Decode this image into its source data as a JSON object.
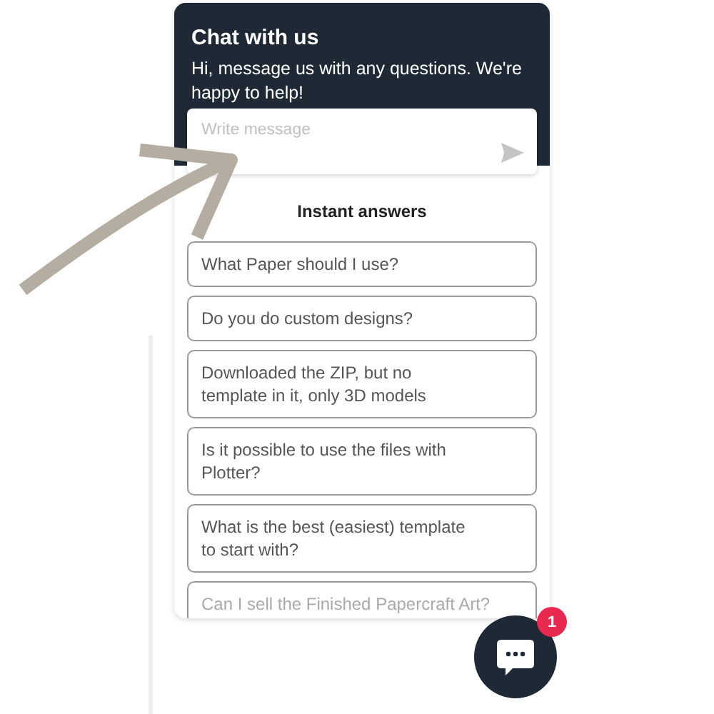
{
  "chat": {
    "title": "Chat with us",
    "subtitle": "Hi, message us with any questions. We're happy to help!",
    "message": {
      "placeholder": "Write message"
    },
    "section_title": "Instant answers",
    "answers": [
      {
        "text": "What Paper should I use?"
      },
      {
        "text": "Do you do custom designs?"
      },
      {
        "text": "Downloaded the ZIP, but no template in it, only 3D models"
      },
      {
        "text": "Is it possible to use the files with Plotter?"
      },
      {
        "text": "What is the best (easiest) template to start with?"
      },
      {
        "text": "Can I sell the Finished Papercraft Art?"
      }
    ]
  },
  "launcher": {
    "badge": "1"
  }
}
